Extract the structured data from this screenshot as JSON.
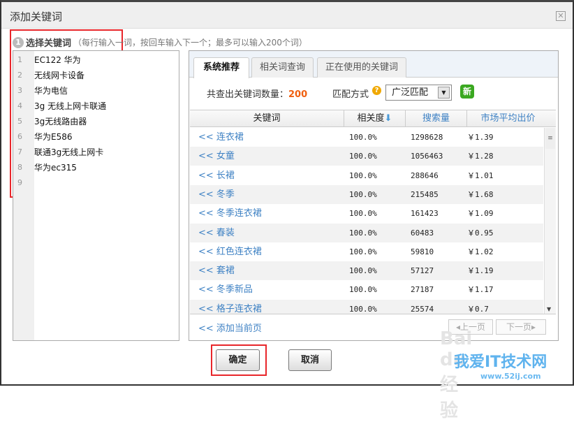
{
  "dialog": {
    "title": "添加关键词",
    "close_icon": "close-icon"
  },
  "step": {
    "number": "1",
    "label": "选择关键词",
    "hint": "（每行输入一词，按回车输入下一个；最多可以输入200个词）"
  },
  "editor": {
    "lines": [
      {
        "n": "1",
        "text": "EC122 华为"
      },
      {
        "n": "2",
        "text": "无线网卡设备"
      },
      {
        "n": "3",
        "text": "华为电信"
      },
      {
        "n": "4",
        "text": "3g 无线上网卡联通"
      },
      {
        "n": "5",
        "text": "3g无线路由器"
      },
      {
        "n": "6",
        "text": "华为E586"
      },
      {
        "n": "7",
        "text": "联通3g无线上网卡"
      },
      {
        "n": "8",
        "text": "华为ec315"
      },
      {
        "n": "9",
        "text": ""
      }
    ]
  },
  "tabs": [
    {
      "label": "系统推荐",
      "active": true
    },
    {
      "label": "相关词查询"
    },
    {
      "label": "正在使用的关键词"
    }
  ],
  "summary": {
    "label": "共查出关键词数量：",
    "count": "200",
    "match_label": "匹配方式",
    "match_value": "广泛匹配",
    "new_badge": "新"
  },
  "table": {
    "headers": [
      "关键词",
      "相关度",
      "搜索量",
      "市场平均出价"
    ],
    "rows": [
      [
        "<< ",
        "连衣裙",
        "100.0%",
        "1298628",
        "￥1.39"
      ],
      [
        "<< ",
        "女童",
        "100.0%",
        "1056463",
        "￥1.28"
      ],
      [
        "<< ",
        "长裙",
        "100.0%",
        "288646",
        "￥1.01"
      ],
      [
        "<< ",
        "冬季",
        "100.0%",
        "215485",
        "￥1.68"
      ],
      [
        "<< ",
        "冬季连衣裙",
        "100.0%",
        "161423",
        "￥1.09"
      ],
      [
        "<< ",
        "春装",
        "100.0%",
        "60483",
        "￥0.95"
      ],
      [
        "<< ",
        "红色连衣裙",
        "100.0%",
        "59810",
        "￥1.02"
      ],
      [
        "<< ",
        "套裙",
        "100.0%",
        "57127",
        "￥1.19"
      ],
      [
        "<< ",
        "冬季新品",
        "100.0%",
        "27187",
        "￥1.17"
      ],
      [
        "<< ",
        "格子连衣裙",
        "100.0%",
        "25574",
        "￥0.7"
      ]
    ]
  },
  "footer": {
    "add_page": "<< 添加当前页",
    "prev": "◂上一页",
    "next": "下一页▸"
  },
  "buttons": {
    "ok": "确定",
    "cancel": "取消"
  },
  "watermark": {
    "brand": "Bai du 经验",
    "site_name": "我爱IT技术网",
    "url": "www.52ij.com"
  },
  "colors": {
    "accent": "#3f82c4",
    "count": "#f06010",
    "highlight": "#e8262a"
  }
}
